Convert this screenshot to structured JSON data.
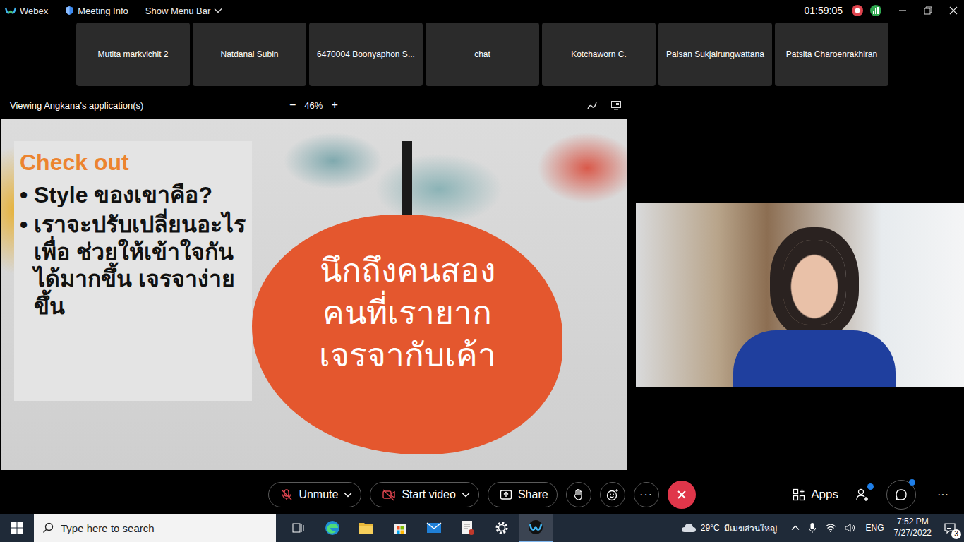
{
  "window": {
    "app": "Webex",
    "meeting_info": "Meeting Info",
    "menu_toggle": "Show Menu Bar",
    "timer": "01:59:05"
  },
  "participants": [
    "Mutita markvichit 2",
    "Natdanai Subin",
    "6470004 Boonyaphon S...",
    "chat",
    "Kotchaworn C.",
    "Paisan Sukjairungwattana",
    "Patsita Charoenrakhiran"
  ],
  "share_bar": {
    "label": "Viewing Angkana's application(s)",
    "zoom_out": "−",
    "zoom": "46%",
    "zoom_in": "+"
  },
  "slide": {
    "heading": "Check out",
    "bullets": [
      {
        "marker": "•",
        "lines": [
          "Style ของเขาคือ?"
        ]
      },
      {
        "marker": "•",
        "lines": [
          "เราจะปรับเปลี่ยนอะไร",
          "เพื่อ ช่วยให้เข้าใจกัน",
          "ได้มากขึ้น เจรจาง่าย",
          "ขึ้น"
        ]
      }
    ],
    "bubble": [
      "นึกถึงคนสอง",
      "คนที่เรายาก",
      "เจรจากับเค้า"
    ]
  },
  "controls": {
    "audio": {
      "label": "Unmute",
      "muted": true
    },
    "video": {
      "label": "Start video",
      "on": false
    },
    "share": "Share",
    "more": "···",
    "apps": "Apps",
    "participants_badge": true,
    "chat_badge": true,
    "overflow": "···"
  },
  "taskbar": {
    "search_placeholder": "Type here to search",
    "weather_temp": "29°C",
    "weather_text": "มีเมฆส่วนใหญ่",
    "language": "ENG",
    "time": "7:52 PM",
    "date": "7/27/2022",
    "notifications": "3"
  }
}
